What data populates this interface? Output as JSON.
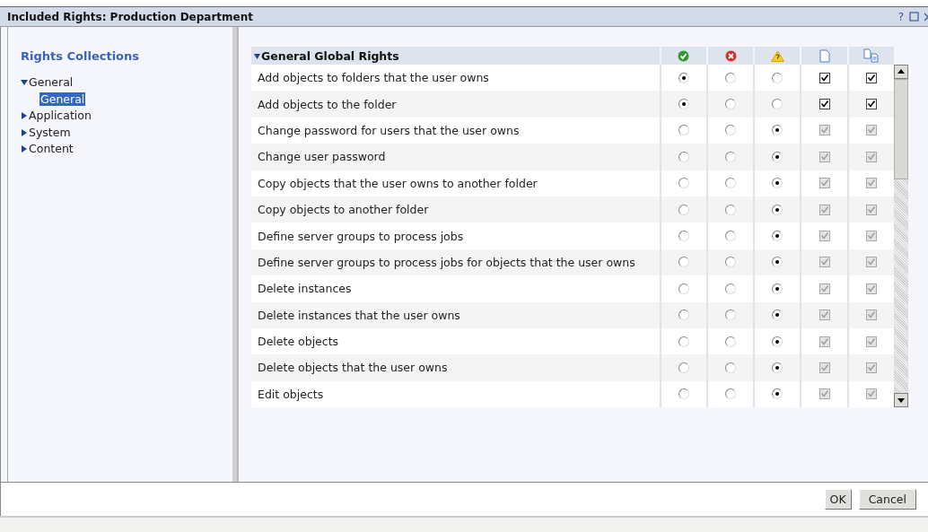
{
  "window": {
    "title": "Included Rights: Production Department",
    "help": "?"
  },
  "sidebar": {
    "title": "Rights Collections",
    "items": [
      {
        "label": "General",
        "expanded": true,
        "children": [
          {
            "label": "General",
            "selected": true
          }
        ]
      },
      {
        "label": "Application",
        "expanded": false
      },
      {
        "label": "System",
        "expanded": false
      },
      {
        "label": "Content",
        "expanded": false
      }
    ]
  },
  "table": {
    "title": "General Global Rights",
    "expanded": true,
    "rows": [
      {
        "label": "Add objects to folders that the user owns",
        "options": [
          {
            "selected": true
          },
          {
            "selected": false
          },
          {
            "selected": false
          }
        ],
        "apply_object": {
          "checked": true,
          "disabled": false
        },
        "apply_sub": {
          "checked": true,
          "disabled": false
        }
      },
      {
        "label": "Add objects to the folder",
        "options": [
          {
            "selected": true
          },
          {
            "selected": false
          },
          {
            "selected": false
          }
        ],
        "apply_object": {
          "checked": true,
          "disabled": false
        },
        "apply_sub": {
          "checked": true,
          "disabled": false
        }
      },
      {
        "label": "Change password for users that the user owns",
        "options": [
          {
            "selected": false
          },
          {
            "selected": false
          },
          {
            "selected": true
          }
        ],
        "apply_object": {
          "checked": true,
          "disabled": true
        },
        "apply_sub": {
          "checked": true,
          "disabled": true
        }
      },
      {
        "label": "Change user password",
        "options": [
          {
            "selected": false
          },
          {
            "selected": false
          },
          {
            "selected": true
          }
        ],
        "apply_object": {
          "checked": true,
          "disabled": true
        },
        "apply_sub": {
          "checked": true,
          "disabled": true
        }
      },
      {
        "label": "Copy objects that the user owns to another folder",
        "options": [
          {
            "selected": false
          },
          {
            "selected": false
          },
          {
            "selected": true
          }
        ],
        "apply_object": {
          "checked": true,
          "disabled": true
        },
        "apply_sub": {
          "checked": true,
          "disabled": true
        }
      },
      {
        "label": "Copy objects to another folder",
        "options": [
          {
            "selected": false
          },
          {
            "selected": false
          },
          {
            "selected": true
          }
        ],
        "apply_object": {
          "checked": true,
          "disabled": true
        },
        "apply_sub": {
          "checked": true,
          "disabled": true
        }
      },
      {
        "label": "Define server groups to process jobs",
        "options": [
          {
            "selected": false
          },
          {
            "selected": false
          },
          {
            "selected": true
          }
        ],
        "apply_object": {
          "checked": true,
          "disabled": true
        },
        "apply_sub": {
          "checked": true,
          "disabled": true
        }
      },
      {
        "label": "Define server groups to process jobs for objects that the user owns",
        "options": [
          {
            "selected": false
          },
          {
            "selected": false
          },
          {
            "selected": true
          }
        ],
        "apply_object": {
          "checked": true,
          "disabled": true
        },
        "apply_sub": {
          "checked": true,
          "disabled": true
        }
      },
      {
        "label": "Delete instances",
        "options": [
          {
            "selected": false
          },
          {
            "selected": false
          },
          {
            "selected": true
          }
        ],
        "apply_object": {
          "checked": true,
          "disabled": true
        },
        "apply_sub": {
          "checked": true,
          "disabled": true
        }
      },
      {
        "label": "Delete instances that the user owns",
        "options": [
          {
            "selected": false
          },
          {
            "selected": false
          },
          {
            "selected": true
          }
        ],
        "apply_object": {
          "checked": true,
          "disabled": true
        },
        "apply_sub": {
          "checked": true,
          "disabled": true
        }
      },
      {
        "label": "Delete objects",
        "options": [
          {
            "selected": false
          },
          {
            "selected": false
          },
          {
            "selected": true
          }
        ],
        "apply_object": {
          "checked": true,
          "disabled": true
        },
        "apply_sub": {
          "checked": true,
          "disabled": true
        }
      },
      {
        "label": "Delete objects that the user owns",
        "options": [
          {
            "selected": false
          },
          {
            "selected": false
          },
          {
            "selected": true
          }
        ],
        "apply_object": {
          "checked": true,
          "disabled": true
        },
        "apply_sub": {
          "checked": true,
          "disabled": true
        }
      },
      {
        "label": "Edit objects",
        "options": [
          {
            "selected": false
          },
          {
            "selected": false
          },
          {
            "selected": true
          }
        ],
        "apply_object": {
          "checked": true,
          "disabled": true
        },
        "apply_sub": {
          "checked": true,
          "disabled": true
        }
      }
    ]
  },
  "buttons": [
    "OK",
    "Cancel"
  ]
}
